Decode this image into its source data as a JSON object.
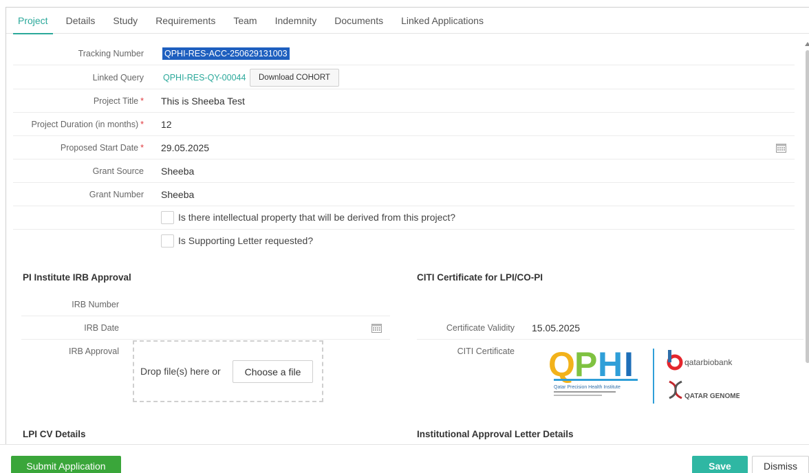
{
  "tabs": [
    "Project",
    "Details",
    "Study",
    "Requirements",
    "Team",
    "Indemnity",
    "Documents",
    "Linked Applications"
  ],
  "active_tab": "Project",
  "form": {
    "tracking_label": "Tracking Number",
    "tracking_value": "QPHI-RES-ACC-250629131003",
    "linked_query_label": "Linked Query",
    "linked_query_value": "QPHI-RES-QY-00044",
    "download_label": "Download COHORT",
    "project_title_label": "Project Title",
    "project_title_value": "This is Sheeba Test",
    "duration_label": "Project Duration (in months)",
    "duration_value": "12",
    "start_date_label": "Proposed Start Date",
    "start_date_value": "29.05.2025",
    "grant_source_label": "Grant Source",
    "grant_source_value": "Sheeba",
    "grant_number_label": "Grant Number",
    "grant_number_value": "Sheeba",
    "ip_question": "Is there intellectual property that will be derived from this project?",
    "letter_question": "Is Supporting Letter requested?",
    "required_mark": "*"
  },
  "irb": {
    "heading": "PI Institute IRB Approval",
    "number_label": "IRB Number",
    "date_label": "IRB Date",
    "approval_label": "IRB Approval",
    "drop_text": "Drop file(s) here or",
    "choose_label": "Choose a file"
  },
  "citi": {
    "heading": "CITI Certificate for LPI/CO-PI",
    "validity_label": "Certificate Validity",
    "validity_value": "15.05.2025",
    "certificate_label": "CITI Certificate",
    "logo": {
      "main_text": "QPHI",
      "institute_line_1": "Qatar Precision Health Institute",
      "biobank_text": "qatarbiobank",
      "genome_text": "QATAR GENOME",
      "colors": {
        "q": "#f2b21a",
        "p": "#7fc241",
        "h": "#2f9fd8",
        "i": "#1e6fb8",
        "biobank": "#e4262d",
        "genome": "#c1272d"
      }
    }
  },
  "sections": {
    "lpi_cv": "LPI CV Details",
    "institutional": "Institutional Approval Letter Details"
  },
  "footer": {
    "submit_label": "Submit Application",
    "save_label": "Save",
    "dismiss_label": "Dismiss"
  },
  "colors": {
    "accent": "#2aa89a",
    "submit": "#3aa63a",
    "save": "#2fb7a3",
    "required": "#e0393e",
    "selection": "#1e5fbf"
  }
}
